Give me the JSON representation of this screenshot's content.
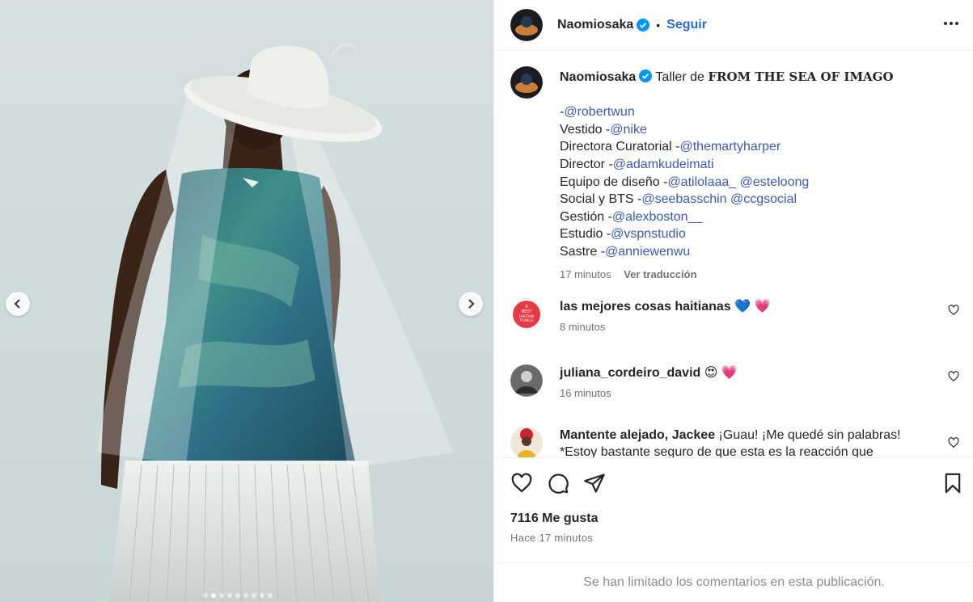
{
  "post": {
    "author": "Naomiosaka",
    "follow_label": "Seguir",
    "separator": "•"
  },
  "media": {
    "slide_count": 9,
    "active_index": 1
  },
  "caption": {
    "author": "Naomiosaka",
    "intro": "Taller de",
    "title": "FROM THE SEA OF IMAGO",
    "lines": [
      {
        "prefix": "-",
        "mentions": [
          "@robertwun"
        ]
      },
      {
        "prefix": "Vestido -",
        "mentions": [
          "@nike"
        ]
      },
      {
        "prefix": "Directora Curatorial -",
        "mentions": [
          "@themartyharper"
        ]
      },
      {
        "prefix": "Director -",
        "mentions": [
          "@adamkudeimati"
        ]
      },
      {
        "prefix": "Equipo de diseño -",
        "mentions": [
          "@atilolaaa_",
          "@esteloong"
        ]
      },
      {
        "prefix": "Social y BTS -",
        "mentions": [
          "@seebasschin",
          "@ccgsocial"
        ]
      },
      {
        "prefix": "Gestión -",
        "mentions": [
          "@alexboston__"
        ]
      },
      {
        "prefix": "Estudio -",
        "mentions": [
          "@vspnstudio"
        ]
      },
      {
        "prefix": "Sastre -",
        "mentions": [
          "@anniewenwu"
        ]
      }
    ],
    "time": "17 minutos",
    "translate": "Ver traducción"
  },
  "comments": [
    {
      "user": "las mejores cosas haitianas",
      "text": "💙 💗",
      "time": "8 minutos",
      "avatar_text": [
        "8",
        "BEST",
        "HAITIAN",
        "THINGS"
      ]
    },
    {
      "user": "juliana_cordeiro_david",
      "text": "😍 💗",
      "time": "16 minutos"
    },
    {
      "user": "Mantente alejado, Jackee",
      "text": "¡Guau! ¡Me quedé sin palabras! *Estoy bastante seguro de que esta es la reacción que",
      "time": ""
    }
  ],
  "footer": {
    "likes": "7116 Me gusta",
    "time_ago": "Hace 17 minutos",
    "limited_notice": "Se han limitado los comentarios en esta publicación."
  },
  "colors": {
    "link": "#3b5ab8",
    "verified": "#0095f6",
    "muted": "#737373"
  }
}
